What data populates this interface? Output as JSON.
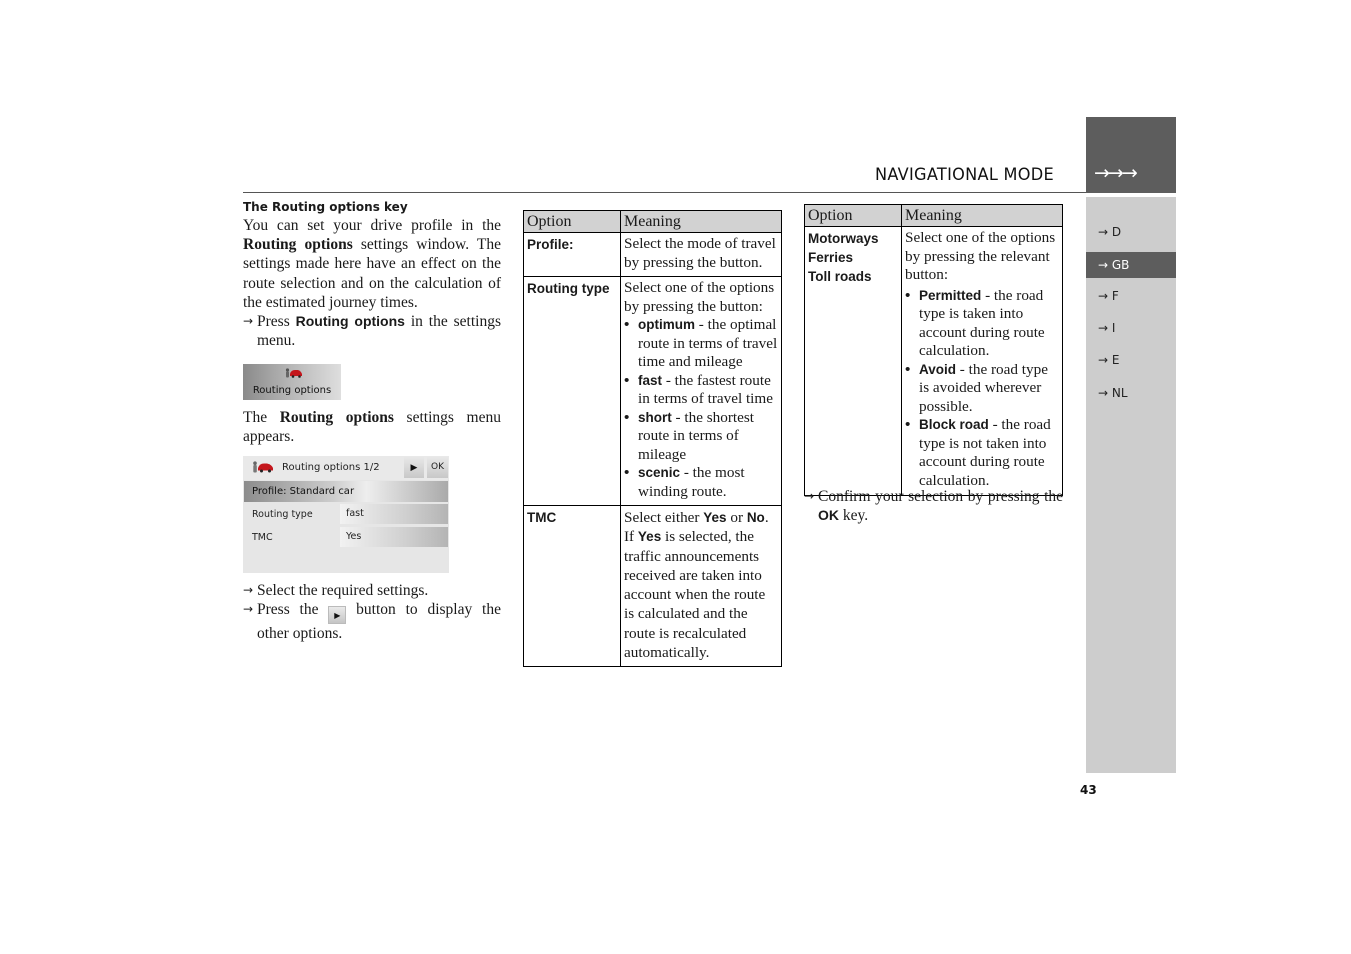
{
  "header": {
    "title": "NAVIGATIONAL MODE",
    "side_arrows": "→→→"
  },
  "languages": [
    {
      "label": "→ D",
      "active": false
    },
    {
      "label": "→ GB",
      "active": true
    },
    {
      "label": "→ F",
      "active": false
    },
    {
      "label": "→ I",
      "active": false
    },
    {
      "label": "→ E",
      "active": false
    },
    {
      "label": "→ NL",
      "active": false
    }
  ],
  "page_number": "43",
  "left": {
    "section_title": "The Routing options key",
    "intro": {
      "p1": "You can set your drive profile in the ",
      "bold": "Routing options",
      "p2": " settings window. The settings made here have an effect on the route selection and on the calculation of the estimated journey times."
    },
    "step1": {
      "arrow": "→",
      "pre": "Press ",
      "bold": "Routing options",
      "post": " in the settings menu."
    },
    "key_image_label": "Routing options",
    "appears": {
      "pre": "The ",
      "bold": "Routing options",
      "post": " settings menu appears."
    },
    "device": {
      "title": "Routing options 1/2",
      "next_button": "▶",
      "ok_button": "OK",
      "profile": "Profile: Standard car",
      "rows": [
        {
          "label": "Routing type",
          "value": "fast"
        },
        {
          "label": "TMC",
          "value": "Yes"
        }
      ]
    },
    "step2": {
      "arrow": "→",
      "text": "Select the required settings."
    },
    "step3": {
      "arrow": "→",
      "pre": "Press the ",
      "button": "▶",
      "post": " button to display the other options."
    }
  },
  "table1": {
    "headers": [
      "Option",
      "Meaning"
    ],
    "profile": {
      "option": "Profile:",
      "meaning": "Select the mode of travel by pressing the button."
    },
    "routing_type": {
      "option": "Routing type",
      "intro": "Select one of the options by pressing the button:",
      "items": [
        {
          "kw": "optimum",
          "text": " - the optimal route in terms of travel time and mileage"
        },
        {
          "kw": "fast",
          "text": " - the fastest route in terms of travel time"
        },
        {
          "kw": "short",
          "text": " - the shortest route in terms of mileage"
        },
        {
          "kw": "scenic",
          "text": " - the most winding route."
        }
      ]
    },
    "tmc": {
      "option": "TMC",
      "t1": "Select either ",
      "yes": "Yes",
      "t2": " or ",
      "no": "No",
      "t3": ". If ",
      "yes2": "Yes",
      "t4": " is selected, the traffic announcements received are taken into account when the route is calculated and the route is recalculated automatically."
    }
  },
  "table2": {
    "headers": [
      "Option",
      "Meaning"
    ],
    "options": [
      "Motorways",
      "Ferries",
      "Toll roads"
    ],
    "intro": "Select one of the options by pressing the relevant button:",
    "items": [
      {
        "kw": "Permitted",
        "text": " - the road type is taken into account during route calculation."
      },
      {
        "kw": "Avoid",
        "text": " - the road type is avoided wherever possible."
      },
      {
        "kw": "Block road",
        "text": " - the road type is not taken into account during route calculation."
      }
    ]
  },
  "confirm": {
    "arrow": "→",
    "pre": "Confirm your selection by pressing the ",
    "bold": "OK",
    "post": " key."
  }
}
